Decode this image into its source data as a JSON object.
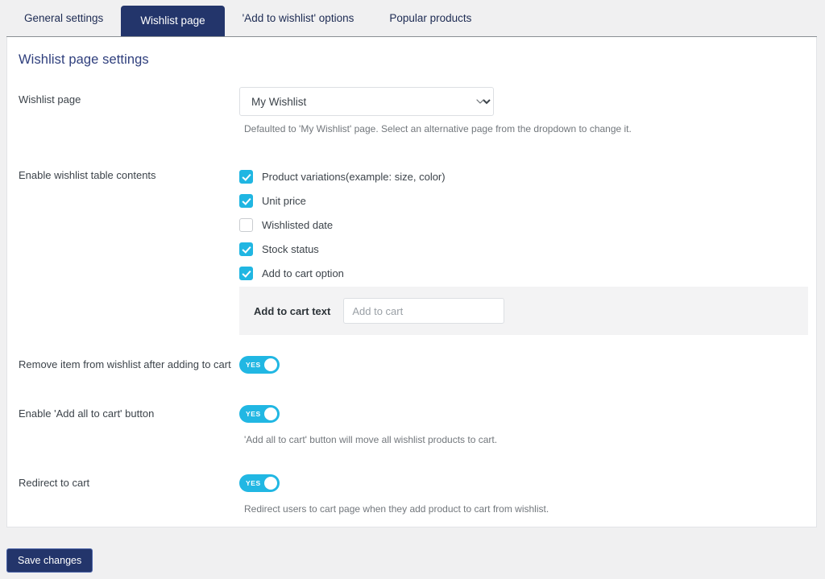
{
  "tabs": [
    {
      "label": "General settings",
      "active": false
    },
    {
      "label": "Wishlist page",
      "active": true
    },
    {
      "label": "'Add to wishlist' options",
      "active": false
    },
    {
      "label": "Popular products",
      "active": false
    }
  ],
  "page": {
    "title": "Wishlist page settings"
  },
  "wishlist_page": {
    "label": "Wishlist page",
    "selected": "My Wishlist",
    "help": "Defaulted to 'My Wishlist' page. Select an alternative page from the dropdown to change it."
  },
  "table_contents": {
    "label": "Enable wishlist table contents",
    "items": [
      {
        "label": "Product variations(example: size, color)",
        "checked": true
      },
      {
        "label": "Unit price",
        "checked": true
      },
      {
        "label": "Wishlisted date",
        "checked": false
      },
      {
        "label": "Stock status",
        "checked": true
      },
      {
        "label": "Add to cart option",
        "checked": true
      }
    ]
  },
  "add_to_cart_text": {
    "label": "Add to cart text",
    "value": "",
    "placeholder": "Add to cart"
  },
  "remove_item": {
    "label": "Remove item from wishlist after adding to cart",
    "state": "YES",
    "help": ""
  },
  "add_all_to_cart": {
    "label": "Enable 'Add all to cart' button",
    "state": "YES",
    "help": "'Add all to cart' button will move all wishlist products to cart."
  },
  "redirect_to_cart": {
    "label": "Redirect to cart",
    "state": "YES",
    "help": "Redirect users to cart page when they add product to cart from wishlist."
  },
  "footer": {
    "save_label": "Save changes"
  },
  "colors": {
    "accent_navy": "#23356b",
    "accent_cyan": "#21b7e3",
    "heading": "#2f3f7d",
    "page_bg": "#f0f0f1",
    "panel_bg": "#f3f3f4"
  }
}
